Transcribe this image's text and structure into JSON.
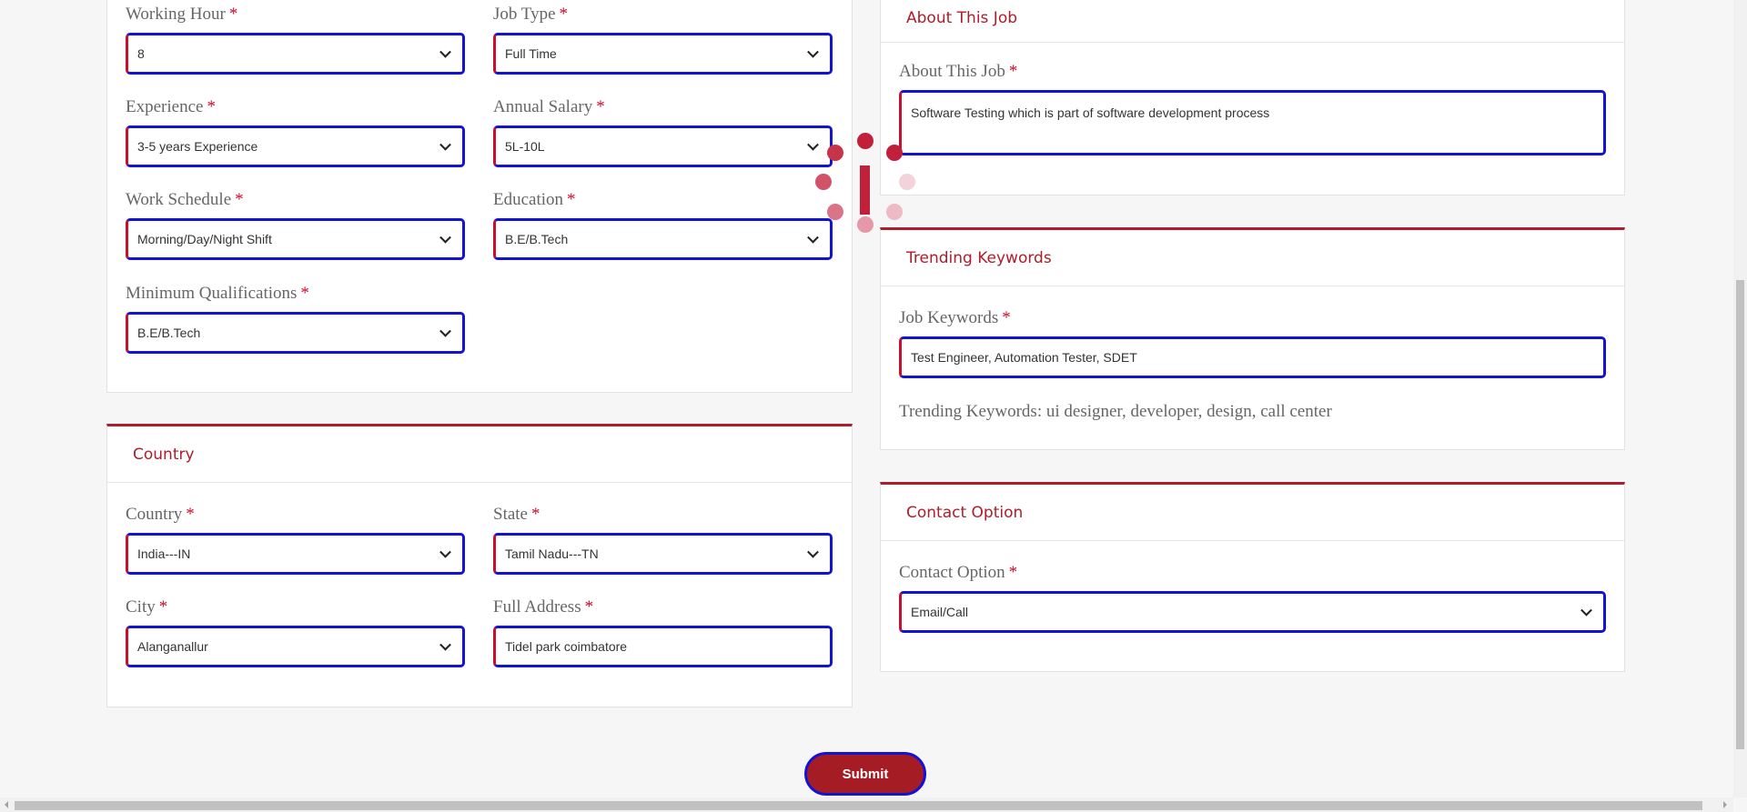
{
  "job_details": {
    "working_hour": {
      "label": "Working Hour",
      "value": "8"
    },
    "job_type": {
      "label": "Job Type",
      "value": "Full Time"
    },
    "experience": {
      "label": "Experience",
      "value": "3-5 years Experience"
    },
    "annual_salary": {
      "label": "Annual Salary",
      "value": "5L-10L"
    },
    "work_schedule": {
      "label": "Work Schedule",
      "value": "Morning/Day/Night Shift"
    },
    "education": {
      "label": "Education",
      "value": "B.E/B.Tech"
    },
    "min_qualifications": {
      "label": "Minimum Qualifications",
      "value": "B.E/B.Tech"
    }
  },
  "country_section": {
    "title": "Country",
    "country": {
      "label": "Country",
      "value": "India---IN"
    },
    "state": {
      "label": "State",
      "value": "Tamil Nadu---TN"
    },
    "city": {
      "label": "City",
      "value": "Alanganallur"
    },
    "full_address": {
      "label": "Full Address",
      "value": "Tidel park coimbatore"
    }
  },
  "about_section": {
    "title": "About This Job",
    "about": {
      "label": "About This Job",
      "value": "Software Testing which is part of software development process"
    }
  },
  "keywords_section": {
    "title": "Trending Keywords",
    "job_keywords": {
      "label": "Job Keywords",
      "value": "Test Engineer, Automation Tester, SDET"
    },
    "trending_text": "Trending Keywords: ui designer, developer, design, call center"
  },
  "contact_section": {
    "title": "Contact Option",
    "contact_option": {
      "label": "Contact Option",
      "value": "Email/Call"
    }
  },
  "required_mark": "*",
  "submit_label": "Submit",
  "colors": {
    "accent": "#b01c2a",
    "focus_border": "#1313d6",
    "required": "#c8102e"
  }
}
